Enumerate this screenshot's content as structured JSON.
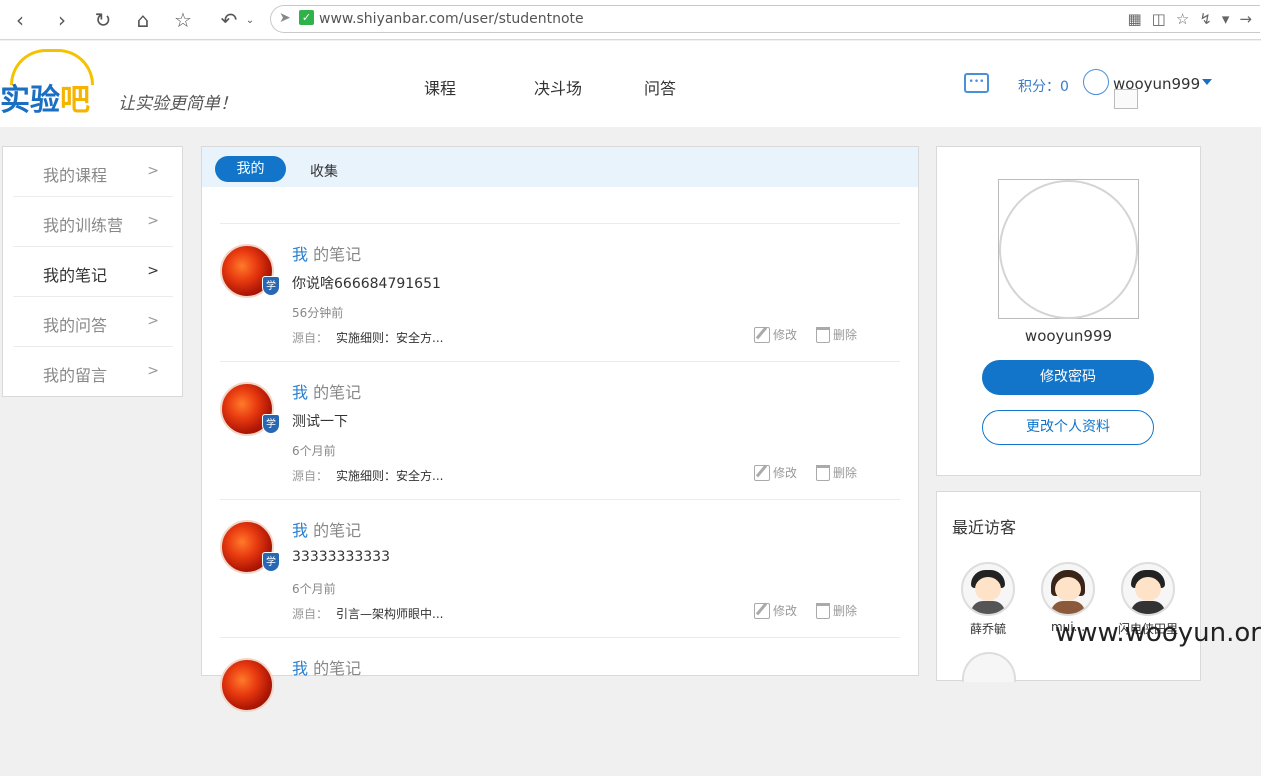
{
  "browser": {
    "url": "www.shiyanbar.com/user/studentnote"
  },
  "header": {
    "logo_text_a": "实验",
    "logo_text_b": "吧",
    "slogan": "让实验更简单！",
    "nav": [
      "课程",
      "决斗场",
      "问答"
    ],
    "points": "积分：0",
    "username": "wooyun999"
  },
  "sidebar": {
    "items": [
      {
        "label": "我的课程",
        "arrow": ">"
      },
      {
        "label": "我的训练营",
        "arrow": ">"
      },
      {
        "label": "我的笔记",
        "arrow": ">"
      },
      {
        "label": "我的问答",
        "arrow": ">"
      },
      {
        "label": "我的留言",
        "arrow": ">"
      }
    ]
  },
  "tabs": {
    "mine": "我的",
    "favorites": "收集"
  },
  "notes": [
    {
      "who": "我",
      "title_rest": " 的笔记",
      "text": "你说啥666684791651",
      "time": "56分钟前",
      "src_label": "源自：",
      "src": "实施细则：安全方...",
      "edit": "修改",
      "delete": "删除",
      "badge": "学"
    },
    {
      "who": "我",
      "title_rest": " 的笔记",
      "text": "测试一下",
      "time": "6个月前",
      "src_label": "源自：",
      "src": "实施细则：安全方...",
      "edit": "修改",
      "delete": "删除",
      "badge": "学"
    },
    {
      "who": "我",
      "title_rest": " 的笔记",
      "text": "33333333333",
      "time": "6个月前",
      "src_label": "源自：",
      "src": "引言—架构师眼中...",
      "edit": "修改",
      "delete": "删除",
      "badge": "学"
    },
    {
      "who": "我",
      "title_rest": " 的笔记"
    }
  ],
  "profile": {
    "name": "wooyun999",
    "change_password": "修改密码",
    "edit_profile": "更改个人资料"
  },
  "visitors": {
    "title": "最近访客",
    "list": [
      {
        "name": "薛乔毓"
      },
      {
        "name": "mui..."
      },
      {
        "name": "闪电侠田里"
      }
    ]
  },
  "watermark": "www.wooyun.org"
}
